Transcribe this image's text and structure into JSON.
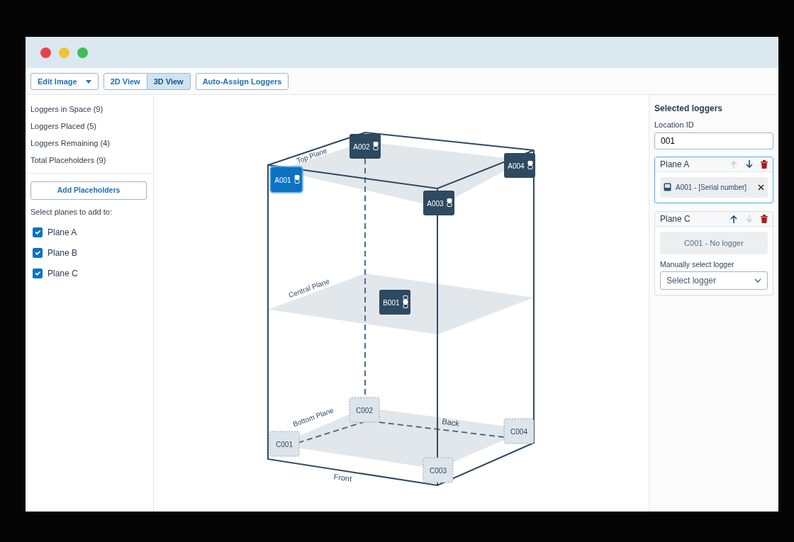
{
  "toolbar": {
    "edit_image": "Edit Image",
    "views": [
      {
        "label": "2D View",
        "selected": false
      },
      {
        "label": "3D View",
        "selected": true
      }
    ],
    "auto_assign": "Auto-Assign Loggers"
  },
  "stats": [
    "Loggers in Space (9)",
    "Loggers Placed (5)",
    "Loggers Remaining (4)",
    "Total Placeholders (9)"
  ],
  "add_placeholders": "Add Placeholders",
  "planes_prompt": "Select planes to add to:",
  "plane_checkboxes": [
    {
      "label": "Plane A",
      "checked": true
    },
    {
      "label": "Plane B",
      "checked": true
    },
    {
      "label": "Plane C",
      "checked": true
    }
  ],
  "canvas": {
    "planes": [
      {
        "label": "Top Plane",
        "loggers": [
          {
            "label": "A001",
            "kind": "placed",
            "selected": true
          },
          {
            "label": "A002",
            "kind": "placed",
            "selected": false
          },
          {
            "label": "A004",
            "kind": "placed",
            "selected": false
          },
          {
            "label": "A003",
            "kind": "placed",
            "selected": false
          }
        ]
      },
      {
        "label": "Central Plane",
        "loggers": [
          {
            "label": "B001",
            "kind": "placed",
            "selected": false
          }
        ]
      },
      {
        "label": "Bottom Plane",
        "loggers": [
          {
            "label": "C002",
            "kind": "placeholder",
            "selected": false
          },
          {
            "label": "C001",
            "kind": "placeholder",
            "selected": false
          },
          {
            "label": "C004",
            "kind": "placeholder",
            "selected": false
          },
          {
            "label": "C003",
            "kind": "placeholder",
            "selected": false
          }
        ]
      }
    ],
    "face_labels": [
      "Back",
      "Front"
    ]
  },
  "panel": {
    "title": "Selected loggers",
    "location_label": "Location ID",
    "location_value": "001",
    "cards": [
      {
        "title": "Plane A",
        "selected": true,
        "up_enabled": false,
        "down_enabled": true,
        "kind": "assigned",
        "logger": "A001 - [Serial number]"
      },
      {
        "title": "Plane C",
        "selected": false,
        "up_enabled": true,
        "down_enabled": false,
        "kind": "unassigned",
        "logger": "C001 - No logger",
        "select_label": "Manually select logger",
        "select_placeholder": "Select logger"
      }
    ]
  }
}
